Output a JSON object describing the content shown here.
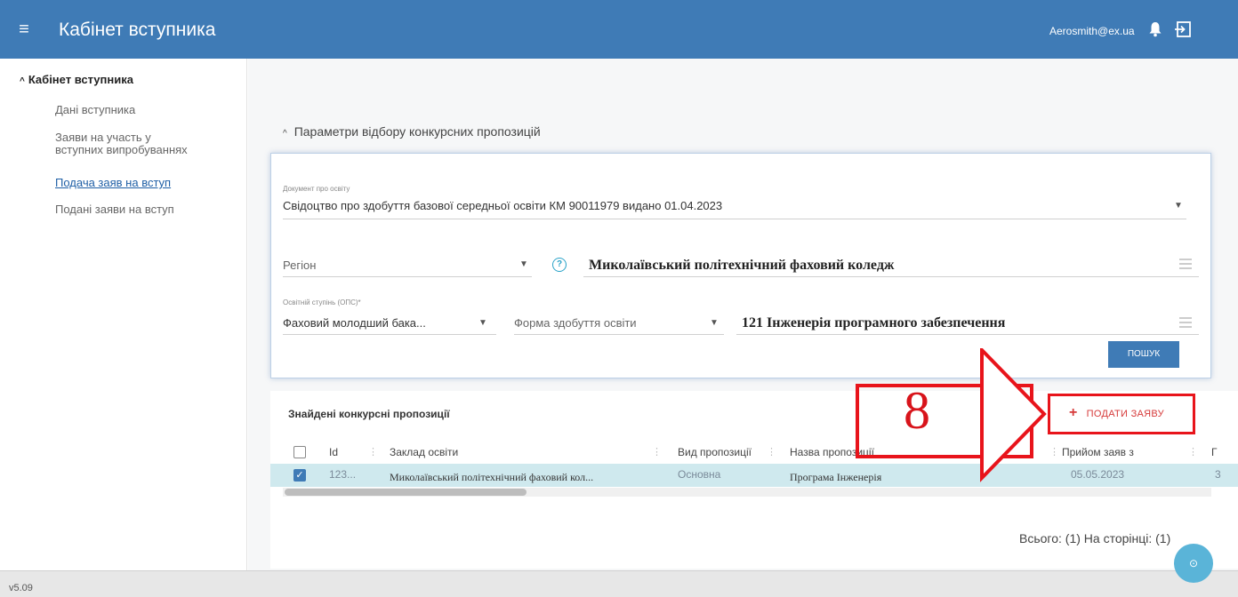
{
  "header": {
    "title": "Кабінет вступника",
    "user_email": "Aerosmith@ex.ua",
    "colors": {
      "bar": "#3f7bb6"
    }
  },
  "sidebar": {
    "header": "Кабінет вступника",
    "items": [
      {
        "label": "Дані вступника",
        "active": false
      },
      {
        "label_line1": "Заяви на участь у",
        "label_line2": "вступних випробуваннях",
        "active": false
      },
      {
        "label": "Подача заяв на вступ",
        "active": true
      },
      {
        "label": "Подані заяви на вступ",
        "active": false
      }
    ]
  },
  "filters": {
    "section_title": "Параметри відбору конкурсних пропозицій",
    "document": {
      "label": "Документ про освіту",
      "value": "Свідоцтво про здобуття базової середньої освіти КМ 90011979 видано 01.04.2023"
    },
    "region": {
      "placeholder": "Регіон"
    },
    "institution": {
      "value": "Миколаївський політехнічний фаховий коледж"
    },
    "degree": {
      "label": "Освітній ступінь (ОПС)*",
      "value": "Фаховий молодший бака..."
    },
    "study_form": {
      "placeholder": "Форма здобуття освіти"
    },
    "specialty": {
      "value": "121 Інженерія програмного забезпечення"
    },
    "search_button": "ПОШУК"
  },
  "results": {
    "title": "Знайдені конкурсні пропозиції",
    "apply_button": "ПОДАТИ ЗАЯВУ",
    "columns": [
      "Id",
      "Заклад освіти",
      "Вид пропозиції",
      "Назва пропозиції",
      "Прийом заяв з",
      "Г"
    ],
    "rows": [
      {
        "checked": true,
        "id": "123...",
        "institution": "Миколаївський політехнічний фаховий кол...",
        "offer_type": "Основна",
        "offer_name": "Програма Інженерія",
        "start_date": "05.05.2023",
        "last": "3"
      }
    ],
    "total": "Всього: (1) На сторінці: (1)"
  },
  "annotation": {
    "step_number": "8",
    "color": "#e8141b"
  },
  "footer": {
    "version": "v5.09"
  }
}
